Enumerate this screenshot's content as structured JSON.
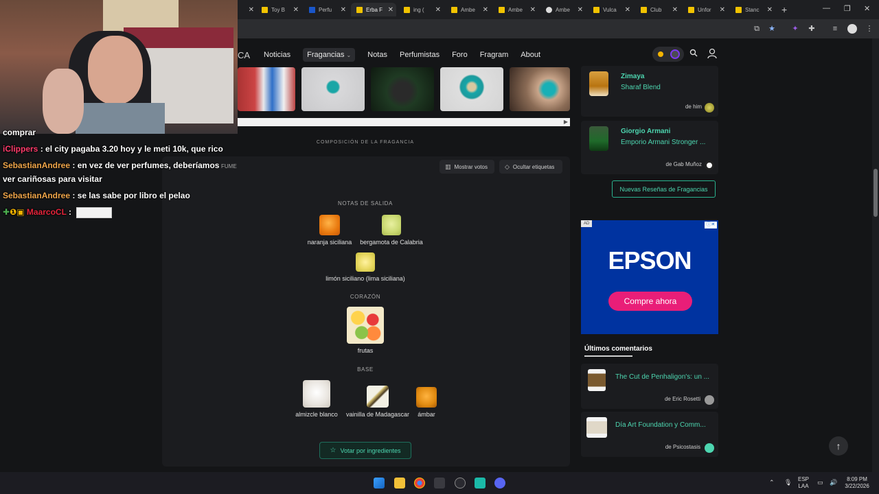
{
  "browser": {
    "tabs": [
      {
        "label": "Toy B",
        "favicon": "flag-yellow-icon"
      },
      {
        "label": "Perfu",
        "favicon": "doc-blue-icon"
      },
      {
        "label": "Erba F",
        "favicon": "flag-yellow-icon",
        "active": true
      },
      {
        "label": "ing (",
        "favicon": "flag-yellow-icon"
      },
      {
        "label": "Ambe",
        "favicon": "flag-yellow-icon"
      },
      {
        "label": "Ambe",
        "favicon": "flag-yellow-icon"
      },
      {
        "label": "Ambe",
        "favicon": "globe-icon"
      },
      {
        "label": "Vulca",
        "favicon": "flag-yellow-icon"
      },
      {
        "label": "Club",
        "favicon": "flag-yellow-icon"
      },
      {
        "label": "Unfor",
        "favicon": "flag-yellow-icon"
      },
      {
        "label": "Stanc",
        "favicon": "flag-yellow-icon"
      }
    ]
  },
  "site": {
    "brand_fragment": "CA",
    "nav": [
      {
        "label": "Noticias"
      },
      {
        "label": "Fragancias",
        "dropdown": true
      },
      {
        "label": "Notas"
      },
      {
        "label": "Perfumistas"
      },
      {
        "label": "Foro"
      },
      {
        "label": "Fragram"
      },
      {
        "label": "About"
      }
    ]
  },
  "composition": {
    "section_title": "COMPOSICIÓN DE LA FRAGANCIA",
    "perf_label_fragment": "FUME",
    "show_votes": "Mostrar votos",
    "hide_labels": "Ocultar etiquetas",
    "top_title": "NOTAS DE SALIDA",
    "top_notes": [
      "naranja siciliana",
      "bergamota de Calabria",
      "limón siciliano (lima siciliana)"
    ],
    "heart_title": "CORAZÓN",
    "heart_notes": [
      "frutas"
    ],
    "base_title": "BASE",
    "base_notes": [
      "almizcle blanco",
      "vainilla de Madagascar",
      "ámbar"
    ],
    "vote_button": "Votar por ingredientes"
  },
  "sidebar": {
    "reviews": [
      {
        "brand": "Zimaya",
        "name": "Sharaf Blend",
        "by": "de him"
      },
      {
        "brand": "Giorgio Armani",
        "name": "Emporio Armani Stronger ...",
        "by": "de Gab Muñoz"
      }
    ],
    "new_reviews_button": "Nuevas Reseñas de Fragancias",
    "ad": {
      "badge": "AD",
      "logo": "EPSON",
      "cta": "Compre ahora",
      "accent": "#e91e78"
    },
    "comments_heading": "Últimos comentarios",
    "comments": [
      {
        "title": "The Cut de Penhaligon's: un ...",
        "by": "de Eric Rosetti"
      },
      {
        "title": "Día Art Foundation y Comm...",
        "by": "de Psicostasis"
      }
    ]
  },
  "chat": [
    {
      "user": "iClippers",
      "color": "#ff3b6b",
      "text": " : el city pagaba 3.20 hoy y le meti 10k, que rico"
    },
    {
      "user": "SebastianAndree",
      "color": "#f0a64a",
      "text": " : en vez de ver perfumes, deberíamos"
    },
    {
      "user": "",
      "color": "#ffffff",
      "text": "ver cariñosas para visitar"
    },
    {
      "user": "SebastianAndree",
      "color": "#f0a64a",
      "text": " : se las sabe por libro el pelao"
    },
    {
      "user": "MaarcoCL",
      "color": "#e5243b",
      "text": " :"
    }
  ],
  "chat_partial_top": "comprar",
  "taskbar": {
    "lang": "ESP",
    "layout": "LAA",
    "time": "8:09 PM",
    "date": "3/22/2026"
  },
  "colors": {
    "accent": "#4dd6b0",
    "page_bg": "#141517"
  }
}
